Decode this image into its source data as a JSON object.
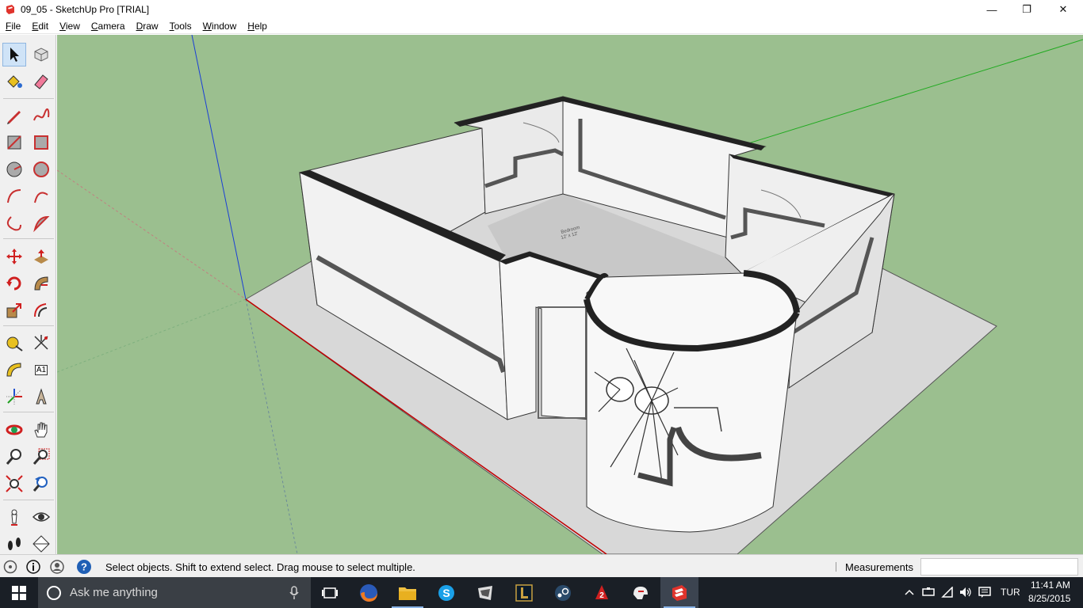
{
  "window": {
    "title": "09_05 - SketchUp Pro [TRIAL]",
    "min_glyph": "—",
    "max_glyph": "❐",
    "close_glyph": "✕"
  },
  "menu": [
    {
      "label": "File",
      "ul": "F",
      "rest": "ile"
    },
    {
      "label": "Edit",
      "ul": "E",
      "rest": "dit"
    },
    {
      "label": "View",
      "ul": "V",
      "rest": "iew"
    },
    {
      "label": "Camera",
      "ul": "C",
      "rest": "amera"
    },
    {
      "label": "Draw",
      "ul": "D",
      "rest": "raw"
    },
    {
      "label": "Tools",
      "ul": "T",
      "rest": "ools"
    },
    {
      "label": "Window",
      "ul": "W",
      "rest": "indow"
    },
    {
      "label": "Help",
      "ul": "H",
      "rest": "elp"
    }
  ],
  "toolbar": {
    "tools": [
      "select",
      "make-component",
      "paint-bucket",
      "eraser",
      "line",
      "freehand",
      "rectangle",
      "rotated-rectangle",
      "circle",
      "polygon",
      "arc",
      "two-point-arc",
      "three-point-arc",
      "pie",
      "move",
      "push-pull",
      "rotate",
      "follow-me",
      "scale",
      "offset",
      "tape-measure",
      "dimension",
      "protractor",
      "text",
      "axes",
      "3d-text",
      "orbit",
      "pan",
      "zoom",
      "zoom-window",
      "zoom-extents",
      "previous-view",
      "position-camera",
      "look-around",
      "walk",
      "section-plane"
    ],
    "text_tool_label": "A1"
  },
  "model": {
    "room_label": "Bedroom",
    "room_dims": "12' x 12'"
  },
  "statusbar": {
    "hint": "Select objects. Shift to extend select. Drag mouse to select multiple.",
    "measurements_label": "Measurements",
    "measurements_value": ""
  },
  "taskbar": {
    "search_placeholder": "Ask me anything",
    "apps": [
      "task-view",
      "firefox",
      "file-explorer",
      "skype",
      "app-5",
      "league-of-legends",
      "steam",
      "app-8",
      "app-9",
      "sketchup"
    ],
    "language": "TUR",
    "time": "11:41 AM",
    "date": "8/25/2015"
  },
  "colors": {
    "sky_ground": "#9bbf8f",
    "axis_red": "#c00000",
    "axis_green": "#1faa1f",
    "axis_blue": "#1a3fd6",
    "taskbar": "#1a1f26"
  }
}
